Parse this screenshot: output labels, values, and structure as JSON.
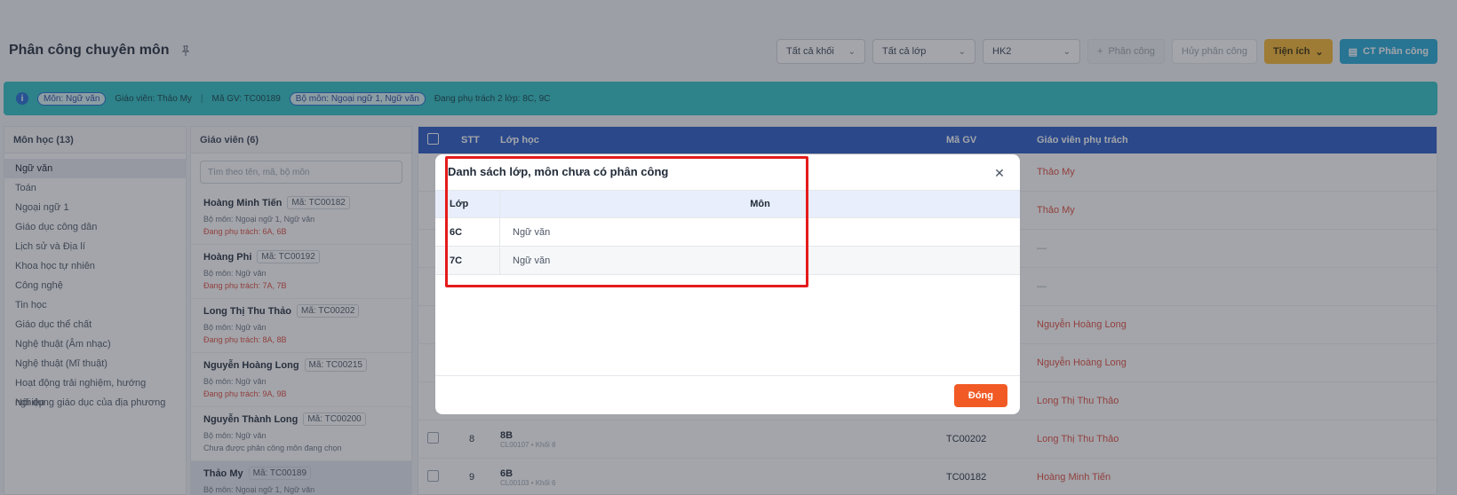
{
  "header": {
    "title": "Phân công chuyên môn",
    "pin_icon": "pin-icon"
  },
  "toolbar": {
    "grade": "Tất cả khối",
    "class": "Tất cả lớp",
    "term": "HK2",
    "assign": "Phân công",
    "cancel": "Hủy phân công",
    "utils": "Tiện ích",
    "detail": "CT Phân công"
  },
  "banner": {
    "subject_chip": "Môn: Ngữ văn",
    "teacher": "Giáo viên: Thảo My",
    "code": "Mã GV: TC00189",
    "dept_chip": "Bộ môn: Ngoại ngữ 1, Ngữ văn",
    "charge": "Đang phụ trách 2 lớp: 8C, 9C"
  },
  "subjects": {
    "header": "Môn học (13)",
    "items": [
      "Ngữ văn",
      "Toán",
      "Ngoại ngữ 1",
      "Giáo dục công dân",
      "Lịch sử và Địa lí",
      "Khoa học tự nhiên",
      "Công nghệ",
      "Tin học",
      "Giáo dục thể chất",
      "Nghệ thuật (Âm nhạc)",
      "Nghệ thuật (Mĩ thuật)",
      "Hoạt động trải nghiệm, hướng nghiệp",
      "Nội dung giáo dục của địa phương"
    ]
  },
  "teachers": {
    "header": "Giáo viên (6)",
    "search_placeholder": "Tìm theo tên, mã, bộ môn",
    "items": [
      {
        "name": "Hoàng Minh Tiến",
        "code": "Mã: TC00182",
        "dept": "Bộ môn: Ngoại ngữ 1, Ngữ văn",
        "charge": "Đang phụ trách: 6A, 6B"
      },
      {
        "name": "Hoàng Phi",
        "code": "Mã: TC00192",
        "dept": "Bộ môn: Ngữ văn",
        "charge": "Đang phụ trách: 7A, 7B"
      },
      {
        "name": "Long Thị Thu Thảo",
        "code": "Mã: TC00202",
        "dept": "Bộ môn: Ngữ văn",
        "charge": "Đang phụ trách: 8A, 8B"
      },
      {
        "name": "Nguyễn Hoàng Long",
        "code": "Mã: TC00215",
        "dept": "Bộ môn: Ngữ văn",
        "charge": "Đang phụ trách: 9A, 9B"
      },
      {
        "name": "Nguyễn Thành Long",
        "code": "Mã: TC00200",
        "dept": "Bộ môn: Ngữ văn",
        "charge": "Chưa được phân công môn đang chọn"
      },
      {
        "name": "Thảo My",
        "code": "Mã: TC00189",
        "dept": "Bộ môn: Ngoại ngữ 1, Ngữ văn",
        "charge": ""
      }
    ]
  },
  "grid": {
    "headers": {
      "stt": "STT",
      "class": "Lớp học",
      "code": "Mã GV",
      "teacher": "Giáo viên phụ trách"
    },
    "right_col": [
      "Thảo My",
      "Thảo My",
      "—",
      "—",
      "Nguyễn Hoàng Long",
      "Nguyễn Hoàng Long",
      "Long Thị Thu Thảo"
    ],
    "rows": [
      {
        "stt": "8",
        "class": "8B",
        "sub": "CL00107 • Khối 8",
        "code": "TC00202",
        "teacher": "Long Thị Thu Thảo"
      },
      {
        "stt": "9",
        "class": "6B",
        "sub": "CL00103 • Khối 6",
        "code": "TC00182",
        "teacher": "Hoàng Minh Tiến"
      }
    ]
  },
  "modal": {
    "title": "Danh sách lớp, môn chưa có phân công",
    "col_class": "Lớp",
    "col_subject": "Môn",
    "rows": [
      {
        "class": "6C",
        "subject": "Ngữ văn"
      },
      {
        "class": "7C",
        "subject": "Ngữ văn"
      }
    ],
    "close_label": "Đóng"
  },
  "colors": {
    "accent": "#2457c5",
    "banner": "#2bc0c4",
    "danger": "#f15a24",
    "highlight": "#e51b1b"
  }
}
